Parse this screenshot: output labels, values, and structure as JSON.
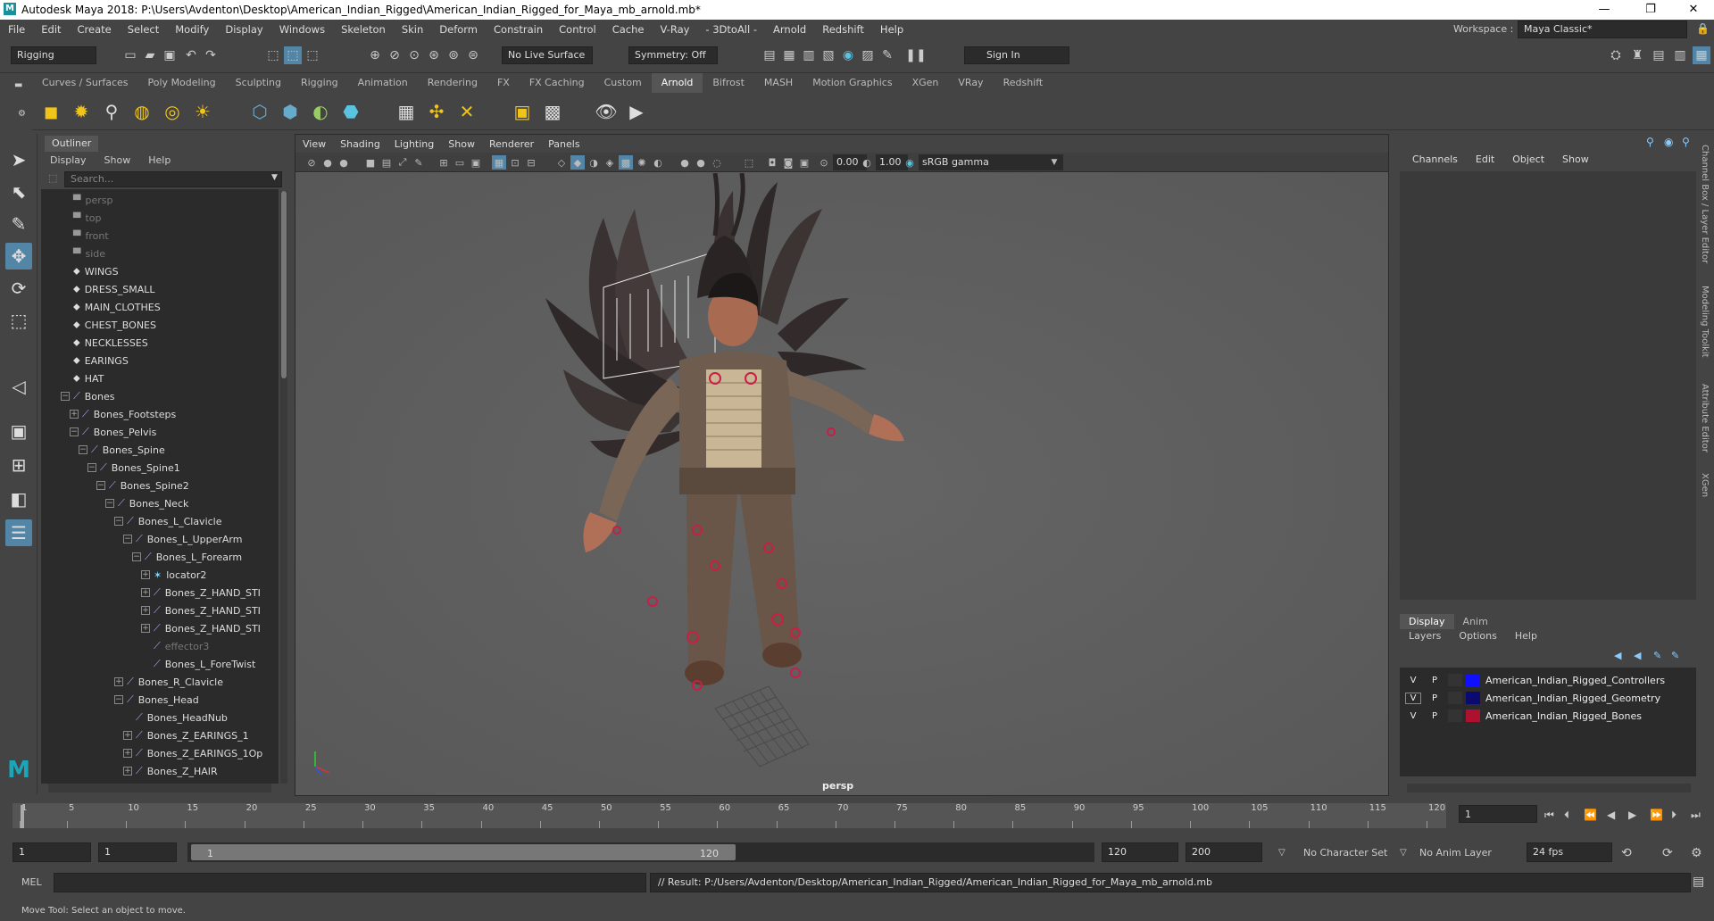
{
  "window": {
    "title": "Autodesk Maya 2018: P:\\Users\\Avdenton\\Desktop\\American_Indian_Rigged\\American_Indian_Rigged_for_Maya_mb_arnold.mb*",
    "minimize": "—",
    "restore": "❐",
    "close": "✕"
  },
  "menubar": {
    "items": [
      "File",
      "Edit",
      "Create",
      "Select",
      "Modify",
      "Display",
      "Windows",
      "Skeleton",
      "Skin",
      "Deform",
      "Constrain",
      "Control",
      "Cache",
      "V-Ray",
      "- 3DtoAll -",
      "Arnold",
      "Redshift",
      "Help"
    ],
    "workspace_label": "Workspace :",
    "workspace_value": "Maya Classic*"
  },
  "statusline": {
    "menuset": "Rigging",
    "live_surface": "No Live Surface",
    "symmetry": "Symmetry: Off",
    "sign_in": "Sign In"
  },
  "shelf": {
    "tabs": [
      "Curves / Surfaces",
      "Poly Modeling",
      "Sculpting",
      "Rigging",
      "Animation",
      "Rendering",
      "FX",
      "FX Caching",
      "Custom",
      "Arnold",
      "Bifrost",
      "MASH",
      "Motion Graphics",
      "XGen",
      "VRay",
      "Redshift"
    ],
    "active_tab": "Arnold"
  },
  "outliner": {
    "title": "Outliner",
    "menu": [
      "Display",
      "Show",
      "Help"
    ],
    "search_placeholder": "Search...",
    "items": [
      {
        "label": "persp",
        "kind": "cam",
        "dim": true,
        "depth": 0,
        "exp": ""
      },
      {
        "label": "top",
        "kind": "cam",
        "dim": true,
        "depth": 0,
        "exp": ""
      },
      {
        "label": "front",
        "kind": "cam",
        "dim": true,
        "depth": 0,
        "exp": ""
      },
      {
        "label": "side",
        "kind": "cam",
        "dim": true,
        "depth": 0,
        "exp": ""
      },
      {
        "label": "WINGS",
        "kind": "grp",
        "dim": false,
        "depth": 0,
        "exp": ""
      },
      {
        "label": "DRESS_SMALL",
        "kind": "grp",
        "dim": false,
        "depth": 0,
        "exp": ""
      },
      {
        "label": "MAIN_CLOTHES",
        "kind": "grp",
        "dim": false,
        "depth": 0,
        "exp": ""
      },
      {
        "label": "CHEST_BONES",
        "kind": "grp",
        "dim": false,
        "depth": 0,
        "exp": ""
      },
      {
        "label": "NECKLESSES",
        "kind": "grp",
        "dim": false,
        "depth": 0,
        "exp": ""
      },
      {
        "label": "EARINGS",
        "kind": "grp",
        "dim": false,
        "depth": 0,
        "exp": ""
      },
      {
        "label": "HAT",
        "kind": "grp",
        "dim": false,
        "depth": 0,
        "exp": ""
      },
      {
        "label": "Bones",
        "kind": "joint",
        "dim": false,
        "depth": 0,
        "exp": "−"
      },
      {
        "label": "Bones_Footsteps",
        "kind": "joint",
        "dim": false,
        "depth": 1,
        "exp": "+"
      },
      {
        "label": "Bones_Pelvis",
        "kind": "joint",
        "dim": false,
        "depth": 1,
        "exp": "−"
      },
      {
        "label": "Bones_Spine",
        "kind": "joint",
        "dim": false,
        "depth": 2,
        "exp": "−"
      },
      {
        "label": "Bones_Spine1",
        "kind": "joint",
        "dim": false,
        "depth": 3,
        "exp": "−"
      },
      {
        "label": "Bones_Spine2",
        "kind": "joint",
        "dim": false,
        "depth": 4,
        "exp": "−"
      },
      {
        "label": "Bones_Neck",
        "kind": "joint",
        "dim": false,
        "depth": 5,
        "exp": "−"
      },
      {
        "label": "Bones_L_Clavicle",
        "kind": "joint",
        "dim": false,
        "depth": 6,
        "exp": "−"
      },
      {
        "label": "Bones_L_UpperArm",
        "kind": "joint",
        "dim": false,
        "depth": 7,
        "exp": "−"
      },
      {
        "label": "Bones_L_Forearm",
        "kind": "joint",
        "dim": false,
        "depth": 8,
        "exp": "−"
      },
      {
        "label": "locator2",
        "kind": "loc",
        "dim": false,
        "depth": 9,
        "exp": "+"
      },
      {
        "label": "Bones_Z_HAND_STI",
        "kind": "joint",
        "dim": false,
        "depth": 9,
        "exp": "+"
      },
      {
        "label": "Bones_Z_HAND_STI",
        "kind": "joint",
        "dim": false,
        "depth": 9,
        "exp": "+"
      },
      {
        "label": "Bones_Z_HAND_STI",
        "kind": "joint",
        "dim": false,
        "depth": 9,
        "exp": "+"
      },
      {
        "label": "effector3",
        "kind": "joint",
        "dim": true,
        "depth": 9,
        "exp": ""
      },
      {
        "label": "Bones_L_ForeTwist",
        "kind": "joint",
        "dim": false,
        "depth": 9,
        "exp": ""
      },
      {
        "label": "Bones_R_Clavicle",
        "kind": "joint",
        "dim": false,
        "depth": 6,
        "exp": "+"
      },
      {
        "label": "Bones_Head",
        "kind": "joint",
        "dim": false,
        "depth": 6,
        "exp": "−"
      },
      {
        "label": "Bones_HeadNub",
        "kind": "joint",
        "dim": false,
        "depth": 7,
        "exp": ""
      },
      {
        "label": "Bones_Z_EARINGS_1",
        "kind": "joint",
        "dim": false,
        "depth": 7,
        "exp": "+"
      },
      {
        "label": "Bones_Z_EARINGS_1Op",
        "kind": "joint",
        "dim": false,
        "depth": 7,
        "exp": "+"
      },
      {
        "label": "Bones_Z_HAIR",
        "kind": "joint",
        "dim": false,
        "depth": 7,
        "exp": "+"
      }
    ]
  },
  "viewport": {
    "menu": [
      "View",
      "Shading",
      "Lighting",
      "Show",
      "Renderer",
      "Panels"
    ],
    "exposure": "0.00",
    "gamma": "1.00",
    "colorspace": "sRGB gamma",
    "camera": "persp"
  },
  "channelbox": {
    "menu": [
      "Channels",
      "Edit",
      "Object",
      "Show"
    ]
  },
  "layers": {
    "tabs": [
      "Display",
      "Anim"
    ],
    "menu": [
      "Layers",
      "Options",
      "Help"
    ],
    "rows": [
      {
        "v": "V",
        "p": "P",
        "name": "American_Indian_Rigged_Controllers",
        "color": "#1010ff"
      },
      {
        "v": "V",
        "p": "P",
        "name": "American_Indian_Rigged_Geometry",
        "color": "#0a0a70"
      },
      {
        "v": "V",
        "p": "P",
        "name": "American_Indian_Rigged_Bones",
        "color": "#b01030"
      }
    ]
  },
  "sidetabs": [
    "Channel Box / Layer Editor",
    "Modeling Toolkit",
    "Attribute Editor",
    "XGen"
  ],
  "timeline": {
    "ticks": [
      "1",
      "5",
      "10",
      "15",
      "20",
      "25",
      "30",
      "35",
      "40",
      "45",
      "50",
      "55",
      "60",
      "65",
      "70",
      "75",
      "80",
      "85",
      "90",
      "95",
      "100",
      "105",
      "110",
      "115",
      "120"
    ],
    "current_frame": "1"
  },
  "range": {
    "start": "1",
    "playback_start": "1",
    "slider_start": "1",
    "slider_end": "120",
    "playback_end": "120",
    "end": "200",
    "character_set": "No Character Set",
    "anim_layer": "No Anim Layer",
    "fps": "24 fps"
  },
  "command": {
    "label": "MEL",
    "result": "// Result: P:/Users/Avdenton/Desktop/American_Indian_Rigged/American_Indian_Rigged_for_Maya_mb_arnold.mb"
  },
  "help": {
    "text": "Move Tool: Select an object to move."
  }
}
